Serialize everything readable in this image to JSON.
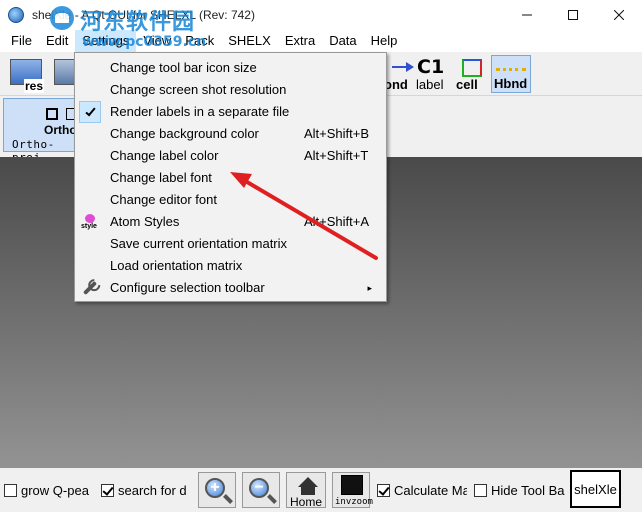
{
  "window": {
    "title": "shelXle - A Qt GUI for SHELXL (Rev: 742)",
    "minimize": "–",
    "maximize": "☐",
    "close": "✕"
  },
  "menubar": [
    "File",
    "Edit",
    "Settings",
    "View",
    "Pack",
    "SHELX",
    "Extra",
    "Data",
    "Help"
  ],
  "toolbar": {
    "res_label": "res",
    "ond_label": "ond",
    "label_big": "C1",
    "label_label": "label",
    "cell_label": "cell",
    "hbnd_label": "Hbnd"
  },
  "ortho": {
    "label": "Ortho",
    "sublabel": "Ortho-proj"
  },
  "settings_menu": {
    "items": [
      {
        "label": "Change tool bar icon size",
        "shortcut": ""
      },
      {
        "label": "Change screen shot resolution",
        "shortcut": ""
      },
      {
        "label": "Render labels in a separate file",
        "shortcut": "",
        "checked": true
      },
      {
        "label": "Change background color",
        "shortcut": "Alt+Shift+B"
      },
      {
        "label": "Change label color",
        "shortcut": "Alt+Shift+T"
      },
      {
        "label": "Change label font",
        "shortcut": ""
      },
      {
        "label": "Change editor font",
        "shortcut": ""
      },
      {
        "label": "Atom Styles",
        "shortcut": "Alt+Shift+A",
        "icon": "style-icon",
        "icon_text": "style"
      },
      {
        "label": "Save current orientation matrix",
        "shortcut": ""
      },
      {
        "label": "Load orientation matrix",
        "shortcut": ""
      },
      {
        "label": "Configure selection toolbar",
        "shortcut": "",
        "icon": "wrench-icon",
        "submenu": "▸"
      }
    ]
  },
  "bottombar": {
    "grow_label": "grow Q-pea",
    "grow_checked": false,
    "search_label": "search for d",
    "search_checked": true,
    "zoom_in": "+",
    "zoom_out": "−",
    "home_label": "Home",
    "invzoom_label": "invzoom",
    "calc_label": "Calculate Ma",
    "calc_checked": true,
    "hide_label": "Hide Tool Ba",
    "hide_checked": false,
    "shelxle_label": "shelXle"
  },
  "watermark": {
    "text": "河东软件园",
    "url": "www.pc0359.cn"
  },
  "colors": {
    "annotation_arrow": "#e02020",
    "menu_highlight": "#cce8ff",
    "viewport_top": "#4a4a4a",
    "viewport_bottom": "#939393"
  }
}
